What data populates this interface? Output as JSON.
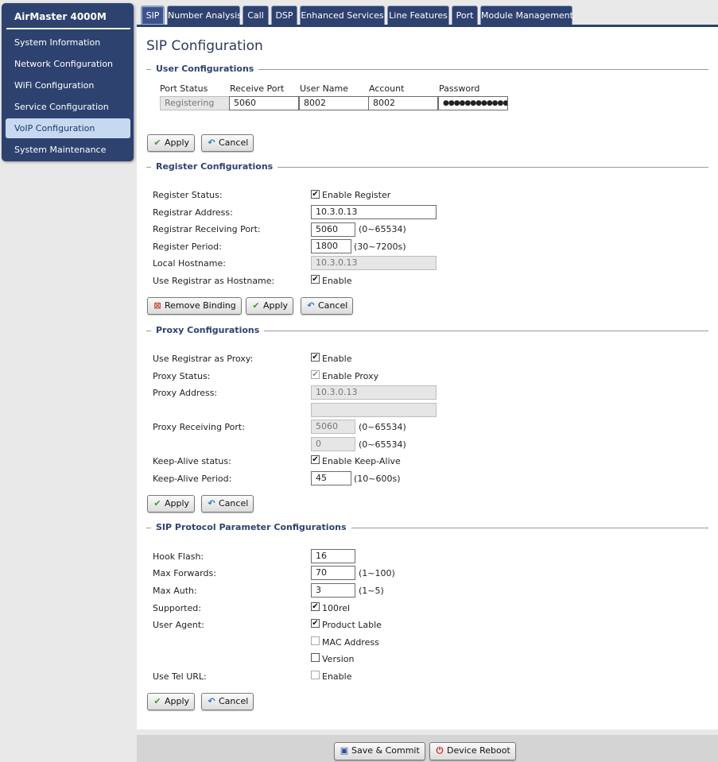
{
  "sidebar": {
    "title": "AirMaster 4000M",
    "items": [
      {
        "label": "System Information"
      },
      {
        "label": "Network Configuration"
      },
      {
        "label": "WiFi Configuration"
      },
      {
        "label": "Service Configuration"
      },
      {
        "label": "VoIP Configuration",
        "active": true
      },
      {
        "label": "System Maintenance"
      }
    ]
  },
  "tabs": [
    {
      "label": "SIP",
      "active": true
    },
    {
      "label": "Number Analysis"
    },
    {
      "label": "Call"
    },
    {
      "label": "DSP"
    },
    {
      "label": "Enhanced Services"
    },
    {
      "label": "Line Features"
    },
    {
      "label": "Port"
    },
    {
      "label": "Module Management"
    }
  ],
  "page_title": "SIP Configuration",
  "user_config": {
    "heading": "User Configurations",
    "columns": [
      "Port Status",
      "Receive Port",
      "User Name",
      "Account",
      "Password"
    ],
    "row": {
      "port_status": "Registering",
      "receive_port": "5060",
      "user_name": "8002",
      "account": "8002",
      "password": "●●●●●●●●●●●●●"
    },
    "apply_label": "Apply",
    "cancel_label": "Cancel"
  },
  "register_config": {
    "heading": "Register Configurations",
    "register_status_label": "Register Status:",
    "enable_register_label": "Enable Register",
    "enable_register_checked": true,
    "registrar_address_label": "Registrar Address:",
    "registrar_address": "10.3.0.13",
    "registrar_port_label": "Registrar Receiving Port:",
    "registrar_port": "5060",
    "registrar_port_hint": "(0~65534)",
    "register_period_label": "Register Period:",
    "register_period": "1800",
    "register_period_hint": "(30~7200s)",
    "local_hostname_label": "Local Hostname:",
    "local_hostname": "10.3.0.13",
    "use_registrar_hostname_label": "Use Registrar as Hostname:",
    "use_registrar_hostname_enable": "Enable",
    "use_registrar_hostname_checked": true,
    "remove_binding_label": "Remove Binding",
    "apply_label": "Apply",
    "cancel_label": "Cancel"
  },
  "proxy_config": {
    "heading": "Proxy Configurations",
    "use_registrar_proxy_label": "Use Registrar as Proxy:",
    "use_registrar_proxy_enable": "Enable",
    "use_registrar_proxy_checked": true,
    "proxy_status_label": "Proxy Status:",
    "enable_proxy_label": "Enable Proxy",
    "enable_proxy_checked": true,
    "proxy_address_label": "Proxy Address:",
    "proxy_address": "10.3.0.13",
    "proxy_address_2": "",
    "proxy_port_label": "Proxy Receiving Port:",
    "proxy_port": "5060",
    "proxy_port_hint": "(0~65534)",
    "proxy_port_2": "0",
    "proxy_port_2_hint": "(0~65534)",
    "keepalive_status_label": "Keep-Alive status:",
    "enable_keepalive_label": "Enable Keep-Alive",
    "enable_keepalive_checked": true,
    "keepalive_period_label": "Keep-Alive Period:",
    "keepalive_period": "45",
    "keepalive_period_hint": "(10~600s)",
    "apply_label": "Apply",
    "cancel_label": "Cancel"
  },
  "sip_protocol": {
    "heading": "SIP Protocol Parameter Configurations",
    "hook_flash_label": "Hook Flash:",
    "hook_flash": "16",
    "max_forwards_label": "Max Forwards:",
    "max_forwards": "70",
    "max_forwards_hint": "(1~100)",
    "max_auth_label": "Max Auth:",
    "max_auth": "3",
    "max_auth_hint": "(1~5)",
    "supported_label": "Supported:",
    "supported_100rel": "100rel",
    "supported_100rel_checked": true,
    "user_agent_label": "User Agent:",
    "product_lable": "Product Lable",
    "product_lable_checked": true,
    "mac_address": "MAC Address",
    "mac_address_checked": false,
    "version": "Version",
    "version_checked": false,
    "use_tel_url_label": "Use Tel URL:",
    "use_tel_url_enable": "Enable",
    "use_tel_url_checked": false,
    "apply_label": "Apply",
    "cancel_label": "Cancel"
  },
  "footer": {
    "save_commit_label": "Save & Commit",
    "device_reboot_label": "Device Reboot"
  },
  "colors": {
    "navy": "#2e4270",
    "active_sidebar": "#c6d9f1",
    "bottom_bar": "#d4d4d4"
  }
}
